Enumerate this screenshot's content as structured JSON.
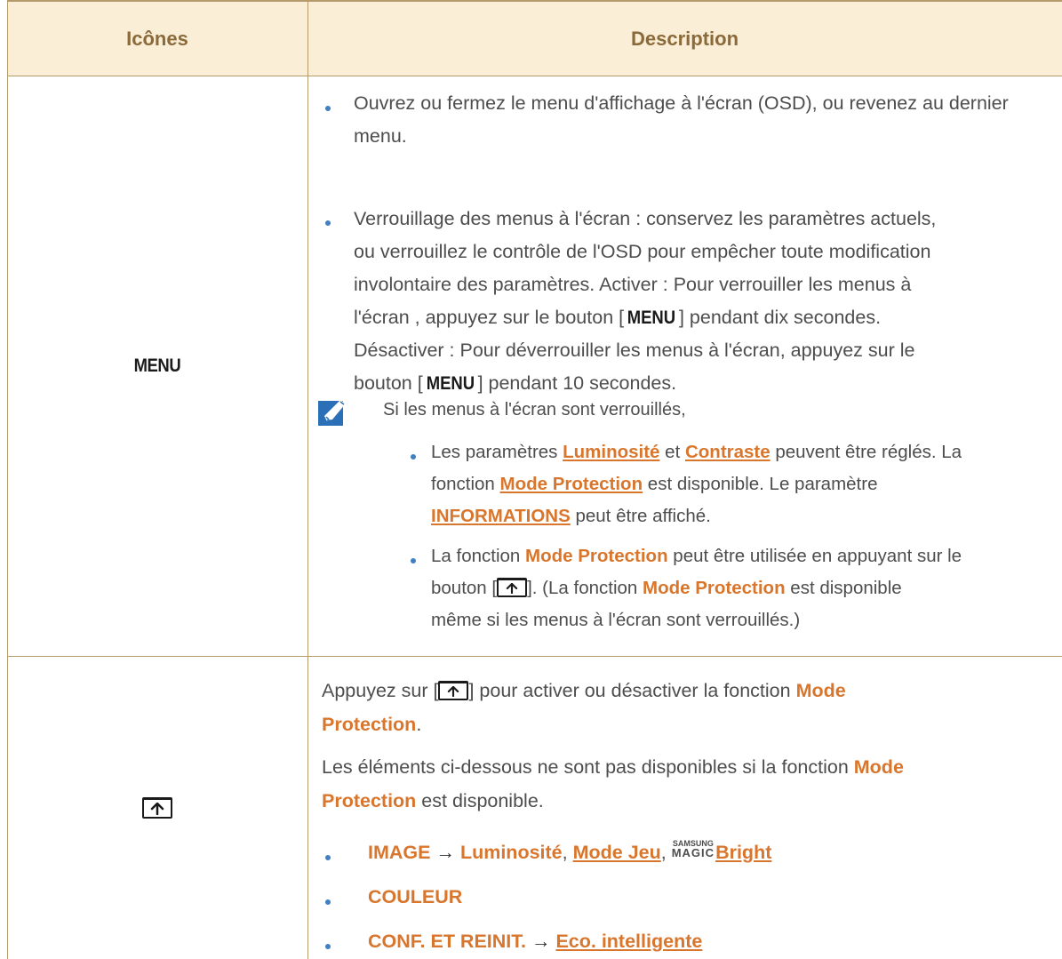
{
  "table": {
    "headers": {
      "icons": "Icônes",
      "description": "Description"
    }
  },
  "row1": {
    "icon_label": "MENU",
    "bullet1": "Ouvrez ou fermez le menu d'affichage à l'écran (OSD), ou revenez au dernier menu.",
    "bullet2_l1": "Verrouillage des menus à l'écran : conservez les paramètres actuels,",
    "bullet2_l2": "ou verrouillez le contrôle de l'OSD pour empêcher toute modification",
    "bullet2_l3": "involontaire des paramètres. Activer : Pour verrouiller les menus à",
    "bullet2_l4a": "l'écran , appuyez sur le bouton [",
    "key_menu": "MENU",
    "bullet2_l4b": "] pendant dix secondes.",
    "bullet2_l5": "Désactiver : Pour déverrouiller les menus à l'écran, appuyez sur le",
    "bullet2_l6a": "bouton [",
    "bullet2_l6b": "] pendant 10 secondes.",
    "note": {
      "intro": "Si les menus à l'écran sont verrouillés,",
      "sub1_a": "Les paramètres ",
      "sub1_luminosite": "Luminosité",
      "sub1_et": " et ",
      "sub1_contraste": "Contraste",
      "sub1_b": " peuvent être réglés. La",
      "sub1_c": "fonction ",
      "mode_protection": "Mode Protection",
      "sub1_d": " est disponible. Le paramètre",
      "sub1_informations": "INFORMATIONS",
      "sub1_e": " peut être affiché.",
      "sub2_a": "La fonction ",
      "sub2_b": " peut être utilisée en appuyant sur le",
      "sub2_c": "bouton [",
      "sub2_d": "]. (La fonction ",
      "sub2_e": " est disponible",
      "sub2_f": "même si les menus à l'écran sont verrouillés.)"
    }
  },
  "row2": {
    "p1_a": "Appuyez sur [",
    "p1_b": "] pour activer ou désactiver la fonction ",
    "mode": "Mode",
    "protection": "Protection",
    "period": ".",
    "p2_a": "Les éléments ci-dessous ne sont pas disponibles si la fonction ",
    "p2_b": " est disponible.",
    "list": {
      "image": "IMAGE",
      "arrow": "→",
      "luminosite": "Luminosité",
      "comma": ",",
      "mode_jeu": "Mode Jeu",
      "samsung": "SAMSUNG",
      "magic": "MAGIC",
      "bright": "Bright",
      "couleur": "COULEUR",
      "conf": "CONF. ET REINIT.",
      "eco": "Eco. intelligente"
    }
  }
}
